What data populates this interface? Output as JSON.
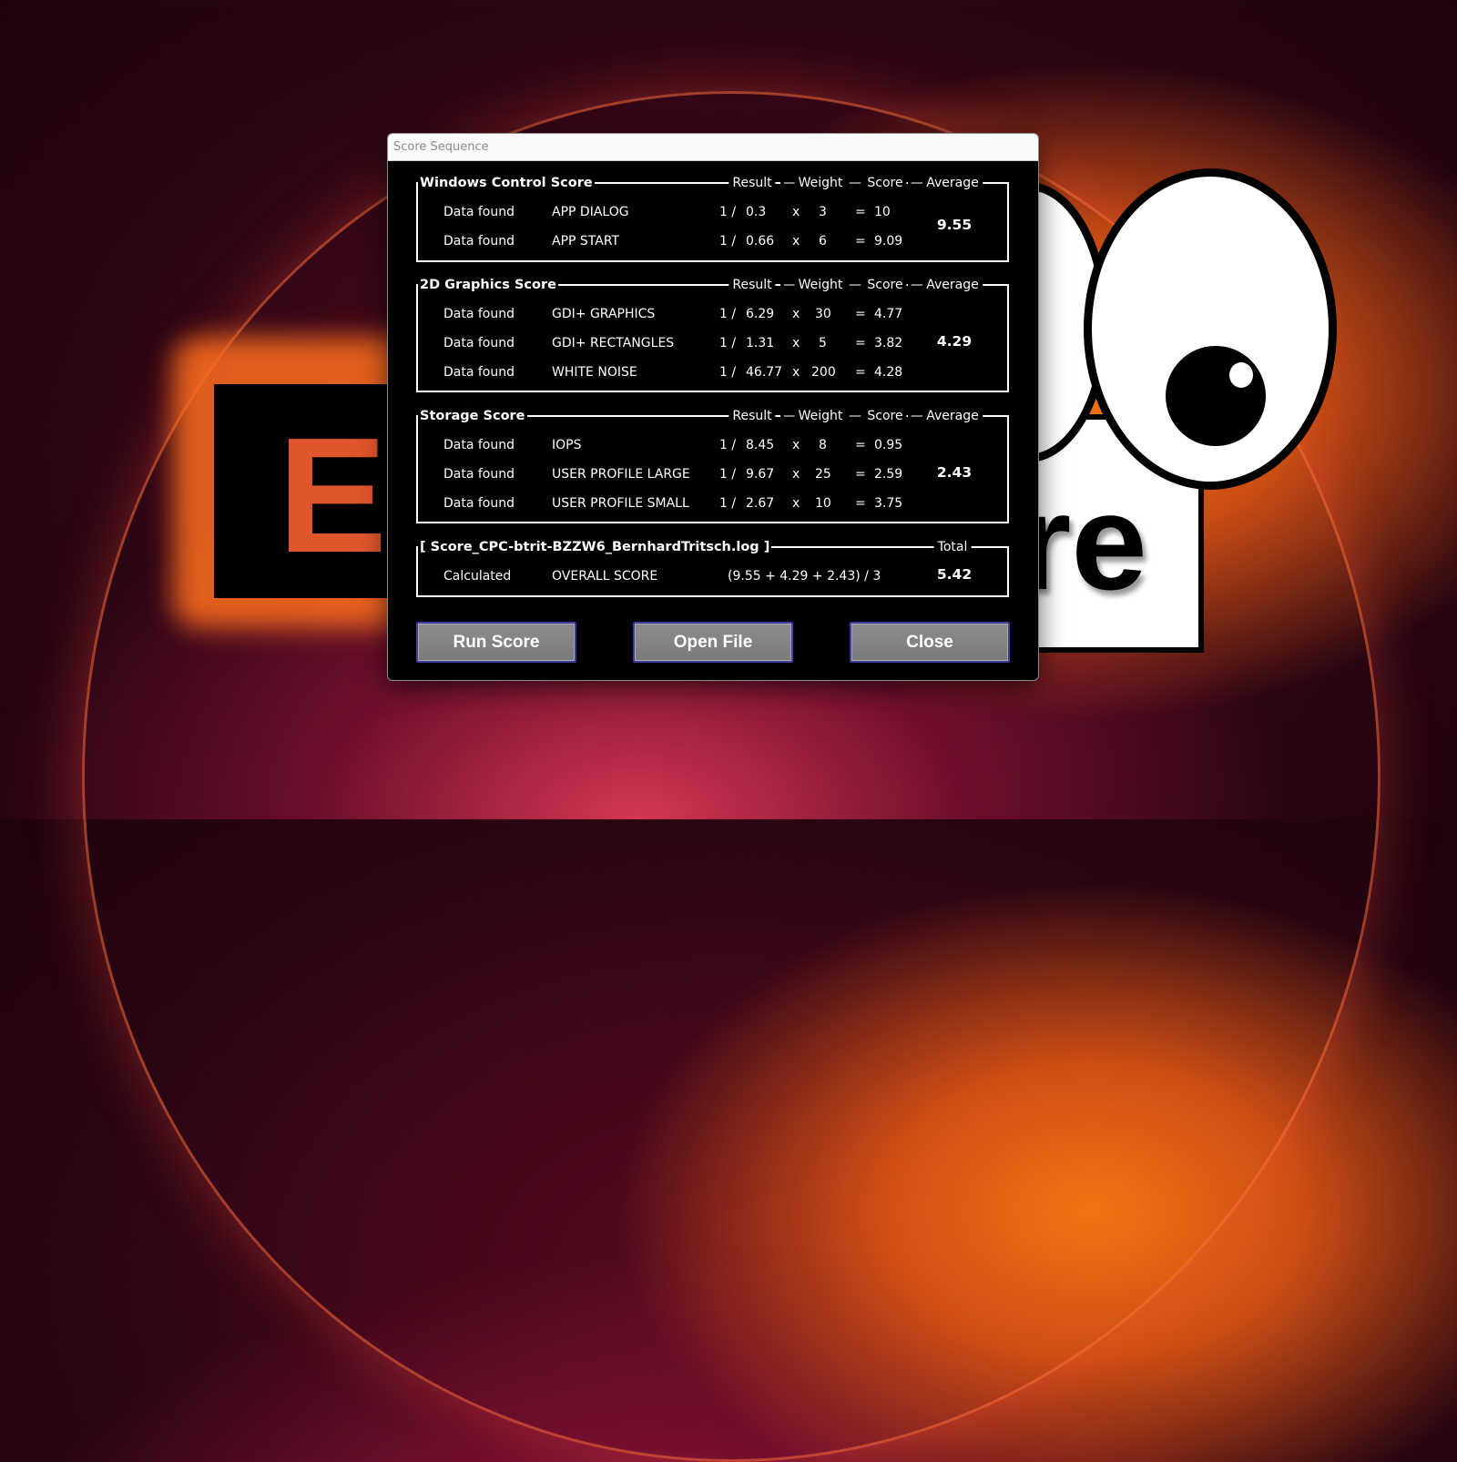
{
  "window": {
    "title": "Score Sequence"
  },
  "columns": {
    "result": "Result",
    "weight": "Weight",
    "score": "Score",
    "average": "Average",
    "total": "Total"
  },
  "groups": [
    {
      "title": "Windows Control Score",
      "average": "9.55",
      "rows": [
        {
          "status": "Data found",
          "name": "APP DIALOG",
          "num": "1 /",
          "result": "0.3",
          "x": "x",
          "weight": "3",
          "eq": "=",
          "score": "10"
        },
        {
          "status": "Data found",
          "name": "APP START",
          "num": "1 /",
          "result": "0.66",
          "x": "x",
          "weight": "6",
          "eq": "=",
          "score": "9.09"
        }
      ]
    },
    {
      "title": "2D Graphics Score",
      "average": "4.29",
      "rows": [
        {
          "status": "Data found",
          "name": "GDI+ GRAPHICS",
          "num": "1 /",
          "result": "6.29",
          "x": "x",
          "weight": "30",
          "eq": "=",
          "score": "4.77"
        },
        {
          "status": "Data found",
          "name": "GDI+ RECTANGLES",
          "num": "1 /",
          "result": "1.31",
          "x": "x",
          "weight": "5",
          "eq": "=",
          "score": "3.82"
        },
        {
          "status": "Data found",
          "name": "WHITE NOISE",
          "num": "1 /",
          "result": "46.77",
          "x": "x",
          "weight": "200",
          "eq": "=",
          "score": "4.28"
        }
      ]
    },
    {
      "title": "Storage Score",
      "average": "2.43",
      "rows": [
        {
          "status": "Data found",
          "name": "IOPS",
          "num": "1 /",
          "result": "8.45",
          "x": "x",
          "weight": "8",
          "eq": "=",
          "score": "0.95"
        },
        {
          "status": "Data found",
          "name": "USER PROFILE LARGE",
          "num": "1 /",
          "result": "9.67",
          "x": "x",
          "weight": "25",
          "eq": "=",
          "score": "2.59"
        },
        {
          "status": "Data found",
          "name": "USER PROFILE SMALL",
          "num": "1 /",
          "result": "2.67",
          "x": "x",
          "weight": "10",
          "eq": "=",
          "score": "3.75"
        }
      ]
    }
  ],
  "total": {
    "title": "[ Score_CPC-btrit-BZZW6_BernhardTritsch.log ]",
    "status": "Calculated",
    "name": "OVERALL SCORE",
    "formula": "(9.55 + 4.29 + 2.43) / 3",
    "value": "5.42"
  },
  "buttons": {
    "run": "Run Score",
    "open": "Open File",
    "close": "Close"
  },
  "background": {
    "logo_left_letter": "E",
    "logo_right_letters": "re"
  },
  "colors": {
    "dialog_bg": "#000000",
    "button_bg": "#808080",
    "button_border": "#3c3c9c",
    "logo_orange": "#e0552c"
  }
}
